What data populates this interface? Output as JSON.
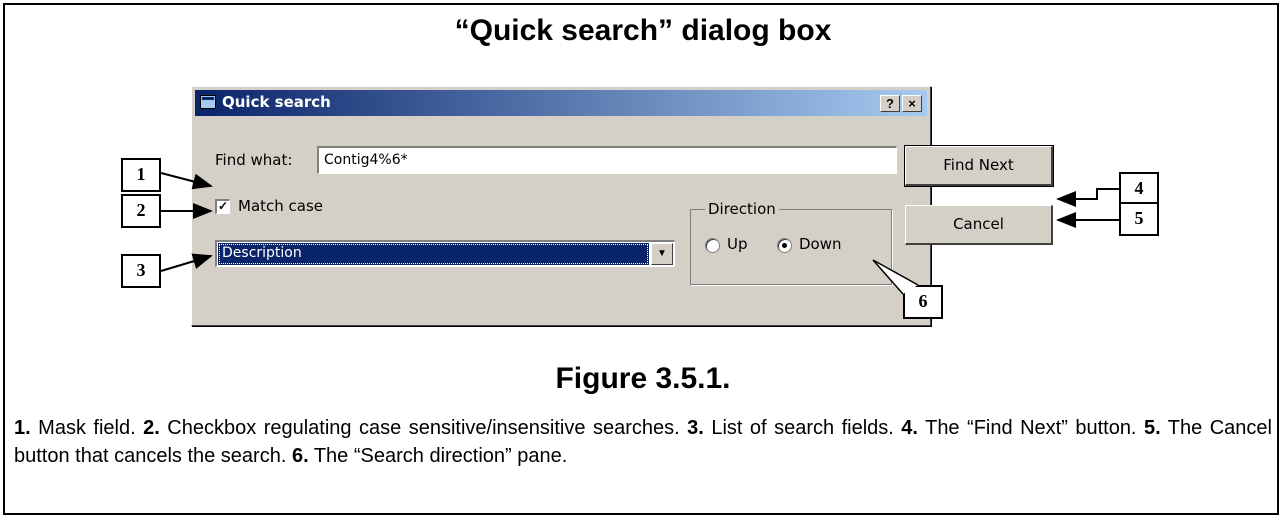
{
  "heading": "“Quick search” dialog box",
  "dialog": {
    "title": "Quick search",
    "help_glyph": "?",
    "close_glyph": "×",
    "find_label": "Find what:",
    "find_value": "Contig4%6*",
    "match_case_label": "Match case",
    "match_case_checked": true,
    "field_select_value": "Description",
    "direction_label": "Direction",
    "radio_up": "Up",
    "radio_down": "Down",
    "direction_selected": "Down",
    "find_next_button": "Find Next",
    "cancel_button": "Cancel"
  },
  "callouts": [
    "1",
    "2",
    "3",
    "4",
    "5",
    "6"
  ],
  "figure_label": "Figure 3.5.1.",
  "caption": [
    {
      "num": "1.",
      "text": " Mask field. "
    },
    {
      "num": "2.",
      "text": " Checkbox regulating case sensitive/insensitive searches. "
    },
    {
      "num": "3.",
      "text": " List of search fields. "
    },
    {
      "num": "4.",
      "text": " The “Find Next” button. "
    },
    {
      "num": "5.",
      "text": " The Cancel button that cancels the search. "
    },
    {
      "num": "6.",
      "text": " The “Search direction” pane."
    }
  ],
  "icons": {
    "window": "window-icon",
    "checkmark": "checkmark-icon",
    "dropdown": "chevron-down-icon"
  }
}
